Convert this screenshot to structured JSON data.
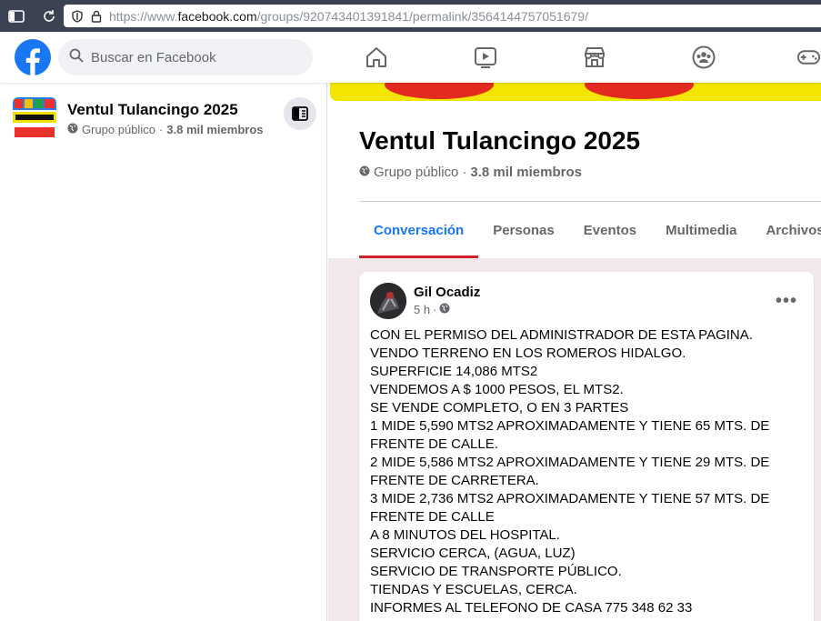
{
  "browser": {
    "url_prefix": "https://www.",
    "url_domain": "facebook.com",
    "url_path": "/groups/920743401391841/permalink/3564144757051679/"
  },
  "fb": {
    "search_placeholder": "Buscar en Facebook",
    "brand_color": "#1877f2"
  },
  "nav": [
    "home-icon",
    "watch-icon",
    "marketplace-icon",
    "groups-icon",
    "gaming-icon"
  ],
  "sidebar": {
    "group_name": "Ventul Tulancingo 2025",
    "privacy": "Grupo público",
    "separator": "·",
    "members": "3.8 mil miembros"
  },
  "group": {
    "name": "Ventul Tulancingo 2025",
    "privacy": "Grupo público",
    "separator": "·",
    "members": "3.8 mil miembros",
    "tabs": [
      {
        "label": "Conversación",
        "active": true
      },
      {
        "label": "Personas",
        "active": false
      },
      {
        "label": "Eventos",
        "active": false
      },
      {
        "label": "Multimedia",
        "active": false
      },
      {
        "label": "Archivos",
        "active": false
      }
    ]
  },
  "post": {
    "author": "Gil Ocadiz",
    "time": "5 h",
    "separator": "·",
    "more": "•••",
    "lines": [
      "CON EL PERMISO DEL ADMINISTRADOR DE ESTA PAGINA.",
      "VENDO TERRENO EN LOS ROMEROS HIDALGO.",
      "SUPERFICIE 14,086 MTS2",
      "VENDEMOS A $ 1000 PESOS, EL MTS2.",
      "SE VENDE COMPLETO, O EN 3 PARTES",
      "1 MIDE 5,590 MTS2 APROXIMADAMENTE Y TIENE 65 MTS. DE FRENTE DE CALLE.",
      "2 MIDE 5,586 MTS2 APROXIMADAMENTE Y TIENE 29 MTS. DE FRENTE DE CARRETERA.",
      "3 MIDE 2,736 MTS2 APROXIMADAMENTE Y TIENE 57 MTS. DE FRENTE DE CALLE",
      "A 8 MINUTOS DEL HOSPITAL.",
      "SERVICIO CERCA, (AGUA, LUZ)",
      "SERVICIO DE TRANSPORTE PÚBLICO.",
      "TIENDAS Y ESCUELAS, CERCA.",
      "INFORMES AL TELEFONO DE CASA 775 348 62 33"
    ]
  }
}
